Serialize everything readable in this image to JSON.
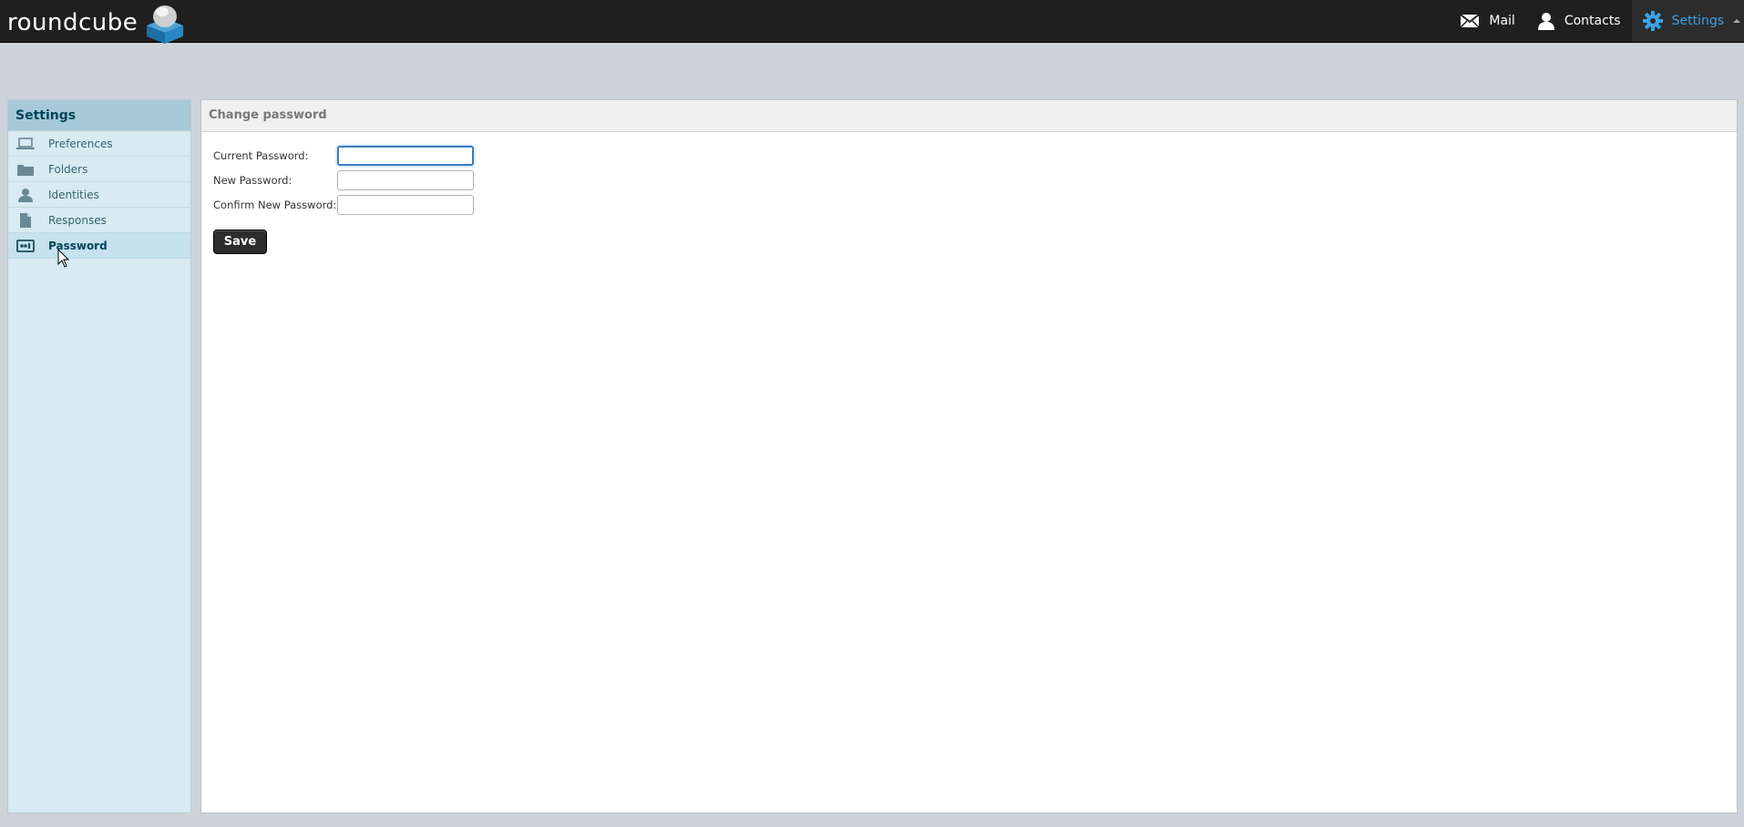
{
  "app": {
    "logo_text": "roundcube",
    "accent_color": "#3ba3e8"
  },
  "topnav": {
    "items": [
      {
        "label": "Mail",
        "icon": "envelope-icon"
      },
      {
        "label": "Contacts",
        "icon": "person-icon"
      },
      {
        "label": "Settings",
        "icon": "gear-icon",
        "active": true
      }
    ]
  },
  "sidebar": {
    "title": "Settings",
    "items": [
      {
        "label": "Preferences",
        "icon": "laptop-icon"
      },
      {
        "label": "Folders",
        "icon": "folder-icon"
      },
      {
        "label": "Identities",
        "icon": "person-icon"
      },
      {
        "label": "Responses",
        "icon": "document-icon"
      },
      {
        "label": "Password",
        "icon": "password-icon",
        "selected": true
      }
    ]
  },
  "main": {
    "title": "Change password",
    "fields": [
      {
        "label": "Current Password:",
        "value": "",
        "focused": true
      },
      {
        "label": "New Password:",
        "value": ""
      },
      {
        "label": "Confirm New Password:",
        "value": ""
      }
    ],
    "save_label": "Save"
  }
}
